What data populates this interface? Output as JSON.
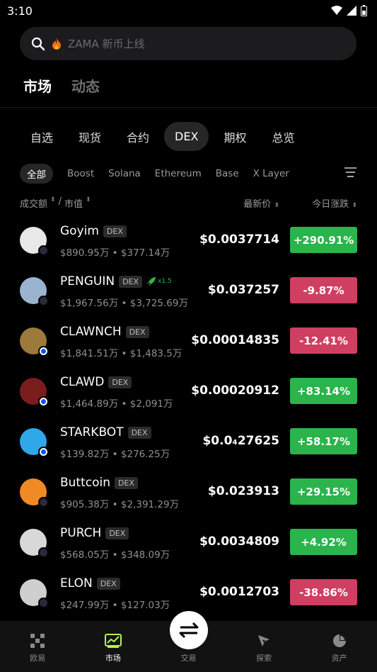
{
  "status": {
    "time": "3:10"
  },
  "search": {
    "placeholder": "ZAMA 新币上线"
  },
  "top_tabs": [
    {
      "label": "市场"
    },
    {
      "label": "动态"
    }
  ],
  "categories": [
    {
      "label": "自选"
    },
    {
      "label": "现货"
    },
    {
      "label": "合约"
    },
    {
      "label": "DEX"
    },
    {
      "label": "期权"
    },
    {
      "label": "总览"
    }
  ],
  "filters": [
    {
      "label": "全部"
    },
    {
      "label": "Boost"
    },
    {
      "label": "Solana"
    },
    {
      "label": "Ethereum"
    },
    {
      "label": "Base"
    },
    {
      "label": "X Layer"
    }
  ],
  "columns": {
    "volume": "成交额",
    "sep": "/",
    "mcap": "市值",
    "price": "最新价",
    "change": "今日涨跌"
  },
  "coins": [
    {
      "name": "Goyim",
      "tag": "DEX",
      "volume": "$890.95万",
      "mcap": "$377.14万",
      "price": "$0.0037714",
      "change": "+290.91%",
      "dir": "up",
      "chain": "sol",
      "color": "#e8e8e8"
    },
    {
      "name": "PENGUIN",
      "tag": "DEX",
      "boost": "x1.5",
      "volume": "$1,967.56万",
      "mcap": "$3,725.69万",
      "price": "$0.037257",
      "change": "-9.87%",
      "dir": "down",
      "chain": "sol",
      "color": "#9ab3cf"
    },
    {
      "name": "CLAWNCH",
      "tag": "DEX",
      "volume": "$1,841.51万",
      "mcap": "$1,483.5万",
      "price": "$0.00014835",
      "change": "-12.41%",
      "dir": "down",
      "chain": "base",
      "color": "#9c7a3c"
    },
    {
      "name": "CLAWD",
      "tag": "DEX",
      "volume": "$1,464.89万",
      "mcap": "$2,091万",
      "price": "$0.00020912",
      "change": "+83.14%",
      "dir": "up",
      "chain": "base",
      "color": "#7a1d1d"
    },
    {
      "name": "STARKBOT",
      "tag": "DEX",
      "volume": "$139.82万",
      "mcap": "$276.25万",
      "price": "$0.0₄27625",
      "change": "+58.17%",
      "dir": "up",
      "chain": "base",
      "color": "#2ea8e8"
    },
    {
      "name": "Buttcoin",
      "tag": "DEX",
      "volume": "$905.38万",
      "mcap": "$2,391.29万",
      "price": "$0.023913",
      "change": "+29.15%",
      "dir": "up",
      "chain": "sol",
      "color": "#f08a24"
    },
    {
      "name": "PURCH",
      "tag": "DEX",
      "volume": "$568.05万",
      "mcap": "$348.09万",
      "price": "$0.0034809",
      "change": "+4.92%",
      "dir": "up",
      "chain": "sol",
      "color": "#d8d8d8"
    },
    {
      "name": "ELON",
      "tag": "DEX",
      "volume": "$247.99万",
      "mcap": "$127.03万",
      "price": "$0.0012703",
      "change": "-38.86%",
      "dir": "down",
      "chain": "sol",
      "color": "#cfcfcf"
    }
  ],
  "bottom_nav": [
    {
      "label": "欧易",
      "icon": "okx-logo-icon"
    },
    {
      "label": "市场",
      "icon": "market-chart-icon"
    },
    {
      "label": "交易",
      "icon": "swap-arrows-icon"
    },
    {
      "label": "探索",
      "icon": "compass-icon"
    },
    {
      "label": "资产",
      "icon": "pie-chart-icon"
    }
  ]
}
